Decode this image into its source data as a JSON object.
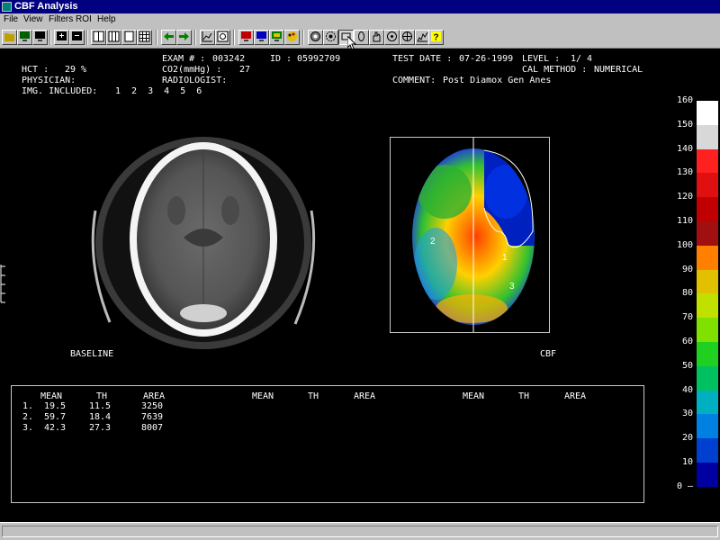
{
  "window": {
    "title": "CBF Analysis"
  },
  "menu": [
    "File",
    "View",
    "Filters",
    "ROI",
    "Help"
  ],
  "header": {
    "exam_label": "EXAM # :",
    "exam_value": "003242",
    "id_label": "ID :",
    "id_value": "05992709",
    "test_date_label": "TEST DATE :",
    "test_date_value": "07-26-1999",
    "level_label": "LEVEL :",
    "level_value": "1/ 4",
    "hct_label": "HCT :",
    "hct_value": "29 %",
    "co2_label": "CO2(mmHg) :",
    "co2_value": "27",
    "cal_method_label": "CAL METHOD :",
    "cal_method_value": "NUMERICAL",
    "physician_label": "PHYSICIAN:",
    "physician_value": "",
    "radiologist_label": "RADIOLOGIST:",
    "radiologist_value": "",
    "comment_label": "COMMENT:",
    "comment_value": "Post Diamox Gen Anes",
    "img_included_label": "IMG. INCLUDED:",
    "img_included_values": "1  2  3  4  5  6"
  },
  "images": {
    "left_label": "BASELINE",
    "right_label": "CBF",
    "roi_labels": [
      "1",
      "2",
      "3"
    ]
  },
  "table": {
    "columns": [
      "MEAN",
      "TH",
      "AREA"
    ],
    "rows": [
      {
        "idx": "1.",
        "mean": "19.5",
        "th": "11.5",
        "area": "3250"
      },
      {
        "idx": "2.",
        "mean": "59.7",
        "th": "18.4",
        "area": "7639"
      },
      {
        "idx": "3.",
        "mean": "42.3",
        "th": "27.3",
        "area": "8007"
      }
    ]
  },
  "legend": {
    "ticks": [
      "160",
      "150",
      "140",
      "130",
      "120",
      "110",
      "100",
      "90",
      "80",
      "70",
      "60",
      "50",
      "40",
      "30",
      "20",
      "10",
      "0"
    ],
    "colors": [
      "#ffffff",
      "#d8d8d8",
      "#ff2020",
      "#e01010",
      "#c00000",
      "#a01010",
      "#ff8000",
      "#e0c000",
      "#c0e000",
      "#80e000",
      "#20d020",
      "#00c060",
      "#00b0c0",
      "#0080e0",
      "#0040d0",
      "#0000a0",
      "#500070"
    ]
  },
  "toolbar_icons": [
    "open-icon",
    "monitor-green-icon",
    "monitor-black-icon",
    "zoom-in-icon",
    "zoom-out-icon",
    "layout-1x2-icon",
    "layout-1x1-icon",
    "layout-single-icon",
    "layout-grid-icon",
    "arrow-left-icon",
    "arrow-right-icon",
    "chart-icon",
    "refresh-icon",
    "monitor-red-icon",
    "monitor-blue-icon",
    "monitor-color-icon",
    "palette-icon",
    "roi-circle-icon",
    "roi-gear-icon",
    "roi-rect-icon",
    "roi-ellipse-icon",
    "roi-hand-icon",
    "roi-target-icon",
    "roi-star-icon",
    "histogram-icon",
    "help-icon"
  ]
}
